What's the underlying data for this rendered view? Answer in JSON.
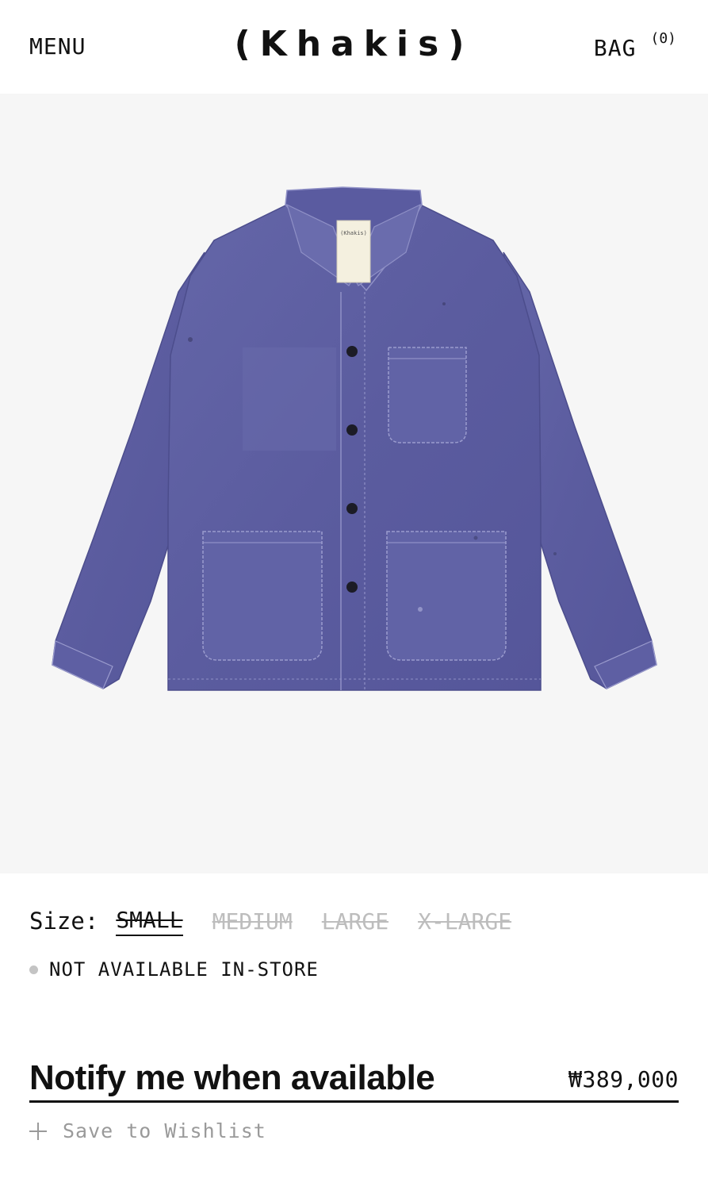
{
  "header": {
    "menu_label": "MENU",
    "logo": "(Khakis)",
    "bag_label": "BAG",
    "bag_count": "(0)"
  },
  "product": {
    "image_icon": "jacket-photo",
    "image_color": "#5e5fa2",
    "tag_text": "(Khakis)"
  },
  "size": {
    "label": "Size:",
    "options": [
      {
        "label": "SMALL",
        "state": "selected-unavailable"
      },
      {
        "label": "MEDIUM",
        "state": "unavailable"
      },
      {
        "label": "LARGE",
        "state": "unavailable"
      },
      {
        "label": "X-LARGE",
        "state": "unavailable"
      }
    ]
  },
  "stock": {
    "text": "NOT AVAILABLE IN-STORE",
    "dot_color": "#c4c4c4"
  },
  "purchase": {
    "notify_label": "Notify me when available",
    "price": "₩389,000"
  },
  "wishlist": {
    "icon": "plus-icon",
    "label": "Save to Wishlist"
  }
}
